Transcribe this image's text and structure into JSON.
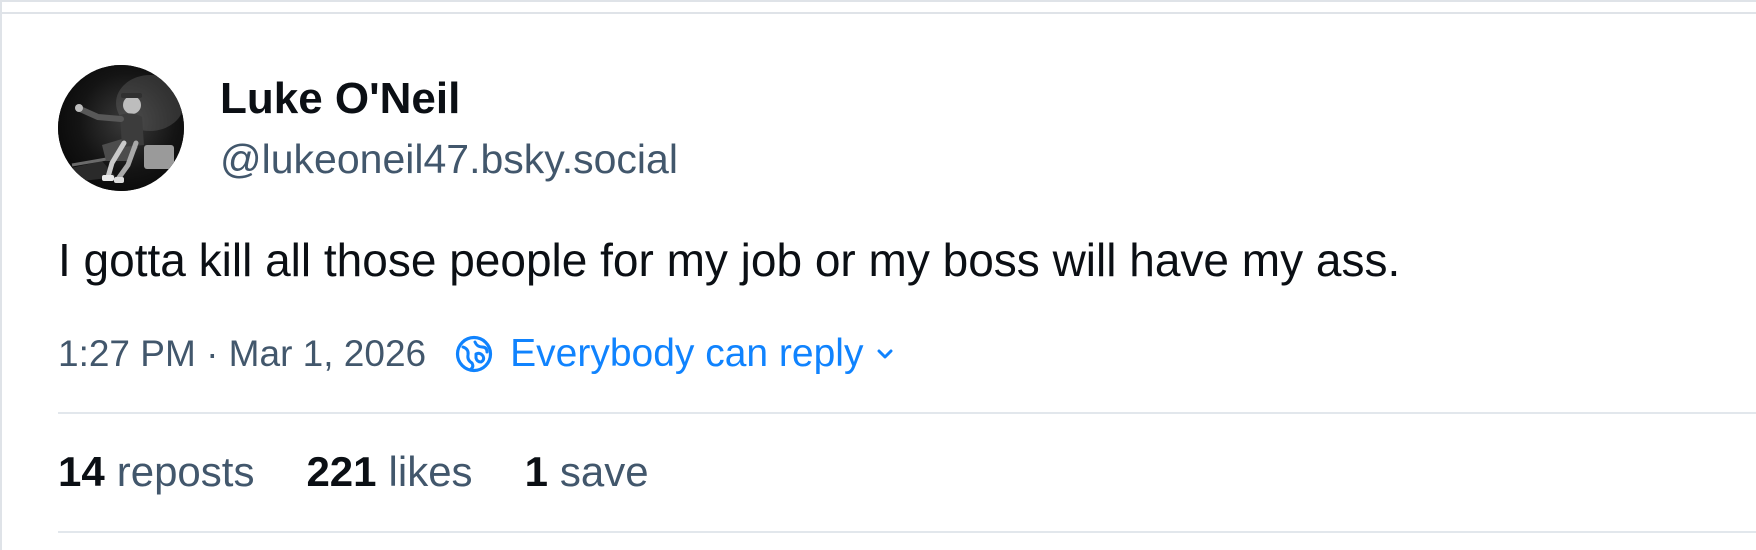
{
  "post": {
    "author": {
      "display_name": "Luke O'Neil",
      "handle": "@lukeoneil47.bsky.social"
    },
    "text": "I gotta kill all those people for my job or my boss will have my ass.",
    "timestamp": "1:27 PM · Mar 1, 2026",
    "reply_setting": {
      "label": "Everybody can reply",
      "icon": "globe-icon",
      "trailing_icon": "chevron-down-icon"
    },
    "stats": {
      "reposts": {
        "count": "14",
        "label": "reposts"
      },
      "likes": {
        "count": "221",
        "label": "likes"
      },
      "saves": {
        "count": "1",
        "label": "save"
      }
    }
  },
  "colors": {
    "text_primary": "#0b0f14",
    "text_secondary": "#42576c",
    "accent": "#1083fe",
    "divider": "#e2e7ec"
  }
}
